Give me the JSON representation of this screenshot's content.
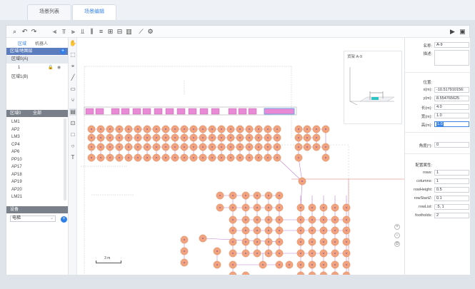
{
  "tabs": [
    {
      "label": "场景列表",
      "active": false
    },
    {
      "label": "场景编辑",
      "active": true
    }
  ],
  "left_panel": {
    "tabs": [
      "区域",
      "机器人"
    ],
    "region_header": "区域/地图层",
    "regions": [
      {
        "label": "区域0(A)",
        "selected": true
      },
      {
        "label": "1",
        "selected": false
      },
      {
        "label": "区域1(B)",
        "selected": false
      }
    ],
    "filter": {
      "region": "区域0",
      "type": "全部"
    },
    "list": [
      "LM1",
      "AP2",
      "LM3",
      "CP4",
      "AP6",
      "PP10",
      "AP17",
      "AP18",
      "AP19",
      "AP20",
      "LM21"
    ],
    "device_header": "设备",
    "device_select": "电梯"
  },
  "map": {
    "scale_label": "3 m",
    "preview_title": "货架 A-9",
    "colors": {
      "node": "#f0a37c",
      "shelf": "#e98ad6",
      "edge": "#b36cc9",
      "accent": "#4aa3e8"
    }
  },
  "properties": {
    "name_label": "名称:",
    "name_value": "A-9",
    "desc_label": "描述:",
    "desc_value": "",
    "position_label": "位置:",
    "x_label": "x(m):",
    "x_value": "-10.517910156:",
    "y_label": "y(m):",
    "y_value": "8.554765625",
    "length_label": "长(m):",
    "length_value": "4.0",
    "width_label": "宽(m):",
    "width_value": "1.0",
    "height_label": "高(m):",
    "height_value": "1.0",
    "angle_label": "角度(°):",
    "angle_value": "0",
    "config_label": "配置属性:",
    "rows_label": "rows:",
    "rows_value": "1",
    "columns_label": "columns:",
    "columns_value": "1",
    "rowheight_label": "rowHeight:",
    "rowheight_value": "0.5",
    "rowstartz_label": "rowStartZ:",
    "rowstartz_value": "0.1",
    "rowlist_label": "rowList:",
    "rowlist_value": ".5, 1",
    "footholds_label": "footholds:",
    "footholds_value": "2"
  }
}
